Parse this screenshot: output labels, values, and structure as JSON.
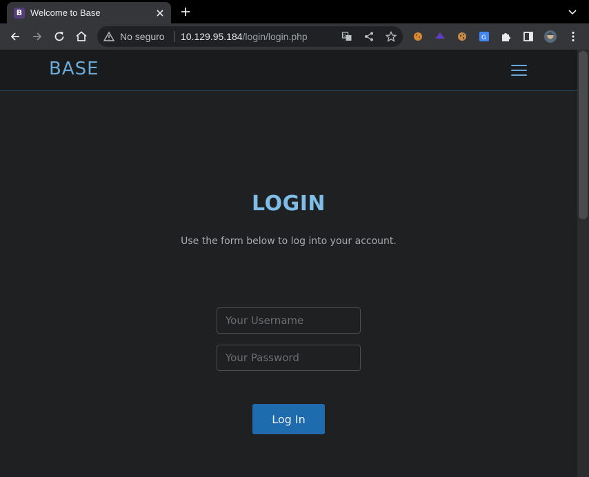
{
  "browser": {
    "tab": {
      "title": "Welcome to Base",
      "favicon_letter": "B"
    },
    "security_label": "No seguro",
    "url": {
      "host": "10.129.95.184",
      "path": "/login/login.php"
    },
    "extension_badge": "11",
    "icons": [
      "back-icon",
      "forward-icon",
      "reload-icon",
      "home-icon",
      "warning-icon",
      "translate-icon",
      "share-icon",
      "star-icon",
      "cookie-icon",
      "puzzle-icon",
      "sidepanel-icon",
      "avatar",
      "kebab-menu-icon"
    ]
  },
  "site": {
    "brand": "BASE",
    "heading": "LOGIN",
    "subtitle": "Use the form below to log into your account.",
    "username_placeholder": "Your Username",
    "password_placeholder": "Your Password",
    "submit_label": "Log In"
  },
  "colors": {
    "accent": "#6aa9d8",
    "button": "#1e6bad",
    "page_bg": "#1f2022",
    "nav_bg": "#1a1b1d"
  }
}
